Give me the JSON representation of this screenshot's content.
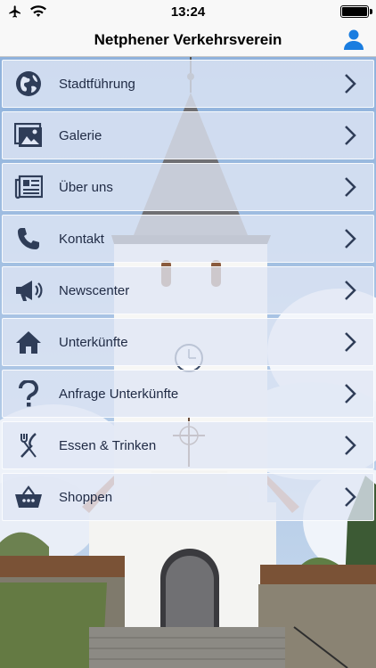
{
  "status_bar": {
    "time": "13:24",
    "icons": [
      "airplane-icon",
      "wifi-icon",
      "battery-icon"
    ]
  },
  "nav": {
    "title": "Netphener Verkehrsverein",
    "right_icon": "user-icon",
    "accent_color": "#1a7de0"
  },
  "menu": {
    "items": [
      {
        "label": "Stadtführung",
        "icon": "globe-icon"
      },
      {
        "label": "Galerie",
        "icon": "photos-icon"
      },
      {
        "label": "Über uns",
        "icon": "newspaper-icon"
      },
      {
        "label": "Kontakt",
        "icon": "phone-icon"
      },
      {
        "label": "Newscenter",
        "icon": "megaphone-icon"
      },
      {
        "label": "Unterkünfte",
        "icon": "home-icon"
      },
      {
        "label": "Anfrage Unterkünfte",
        "icon": "question-icon"
      },
      {
        "label": "Essen & Trinken",
        "icon": "fork-knife-icon"
      },
      {
        "label": "Shoppen",
        "icon": "basket-icon"
      }
    ]
  },
  "background": {
    "subject": "white church tower",
    "sky_color": "#aac4e6"
  }
}
